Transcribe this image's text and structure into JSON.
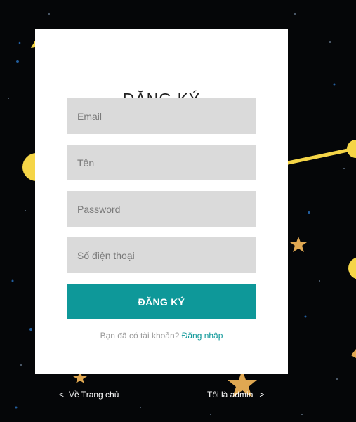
{
  "form": {
    "title": "ĐĂNG KÝ",
    "email_placeholder": "Email",
    "name_placeholder": "Tên",
    "password_placeholder": "Password",
    "phone_placeholder": "Số điện thoại",
    "submit_label": "ĐĂNG KÝ",
    "have_account_text": "Bạn đã có tài khoản?",
    "login_link": "Đăng nhập"
  },
  "footer": {
    "back_arrow": "<",
    "back_label": "Về Trang chủ",
    "admin_label": "Tôi là admin",
    "admin_arrow": ">"
  },
  "colors": {
    "background": "#050608",
    "card": "#ffffff",
    "input_fill": "#dadada",
    "accent": "#0e9899",
    "decor_yellow": "#f5d547"
  }
}
